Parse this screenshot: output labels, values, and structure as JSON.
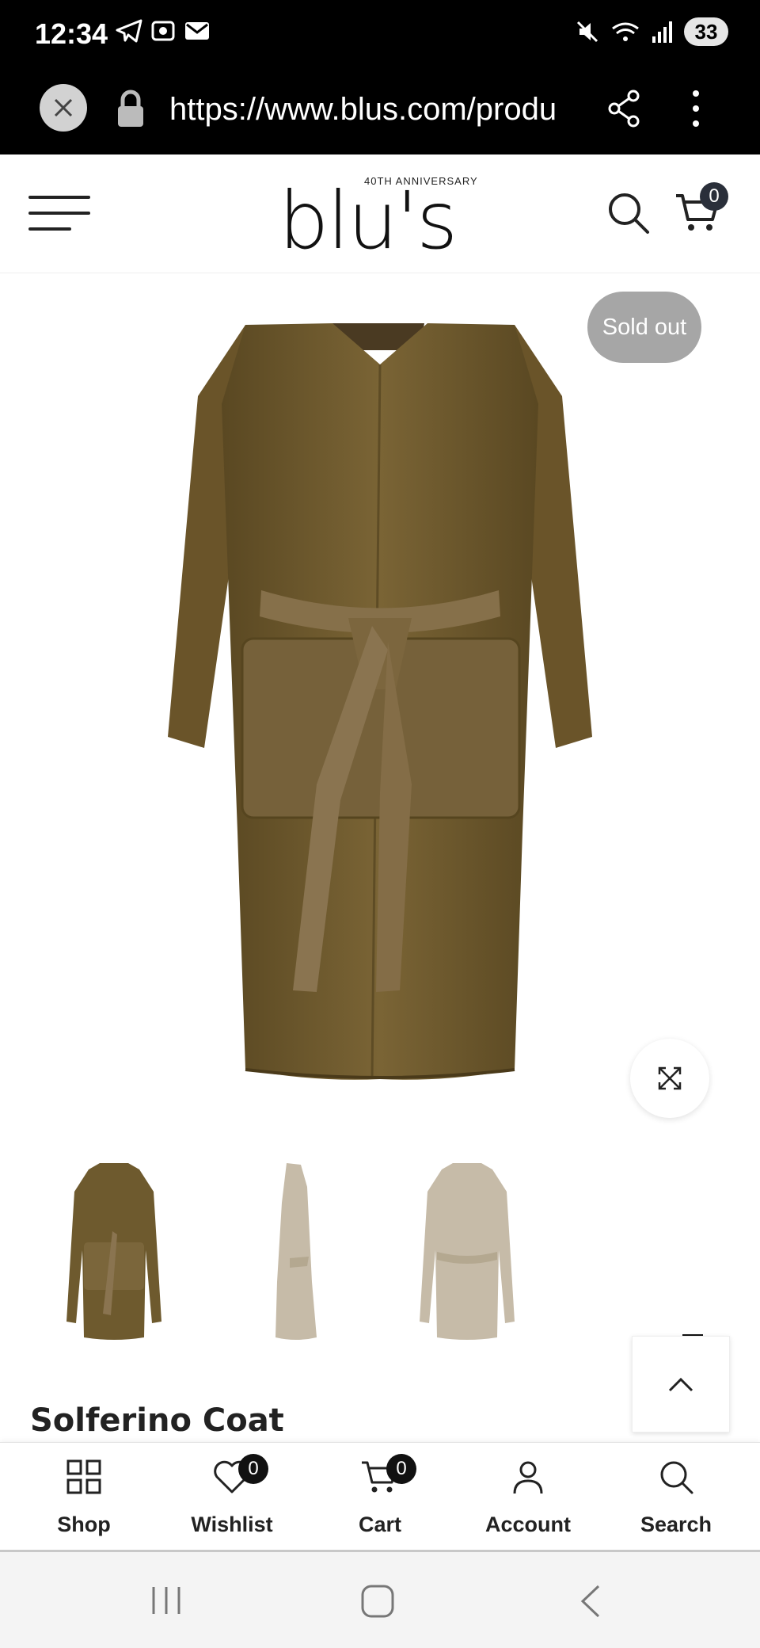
{
  "status_bar": {
    "time": "12:34",
    "battery": "33"
  },
  "browser": {
    "url": "https://www.blus.com/produ"
  },
  "header": {
    "logo_tagline": "40TH ANNIVERSARY",
    "logo_text": "blu's",
    "cart_count": "0"
  },
  "product": {
    "badge": "Sold out",
    "title": "Solferino Coat",
    "thumbnails": [
      "front-olive",
      "side-beige",
      "front-beige"
    ]
  },
  "bottom_nav": {
    "items": [
      {
        "label": "Shop",
        "icon": "grid-icon"
      },
      {
        "label": "Wishlist",
        "icon": "heart-icon",
        "badge": "0"
      },
      {
        "label": "Cart",
        "icon": "cart-icon",
        "badge": "0"
      },
      {
        "label": "Account",
        "icon": "user-icon"
      },
      {
        "label": "Search",
        "icon": "search-icon"
      }
    ]
  },
  "colors": {
    "coat_olive": "#6e5a2e",
    "coat_beige": "#c6bba8",
    "badge_gray": "#a6a6a6"
  }
}
